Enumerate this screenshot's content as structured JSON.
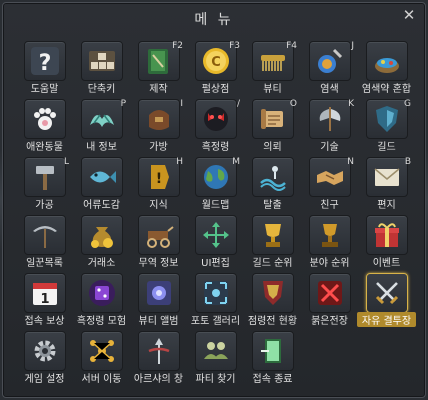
{
  "window": {
    "title": "메 뉴",
    "close_label": "✕"
  },
  "items": [
    {
      "label": "도움말",
      "hotkey": "",
      "icon": "question-icon"
    },
    {
      "label": "단축키",
      "hotkey": "",
      "icon": "keyboard-icon"
    },
    {
      "label": "제작",
      "hotkey": "F2",
      "icon": "crafting-book-icon"
    },
    {
      "label": "펄상점",
      "hotkey": "F3",
      "icon": "pearl-coin-icon"
    },
    {
      "label": "뷰티",
      "hotkey": "F4",
      "icon": "comb-icon"
    },
    {
      "label": "염색",
      "hotkey": "J",
      "icon": "dye-brush-icon"
    },
    {
      "label": "염색약 혼합",
      "hotkey": "",
      "icon": "dye-mix-icon"
    },
    {
      "label": "애완동물",
      "hotkey": "",
      "icon": "paw-icon"
    },
    {
      "label": "내 정보",
      "hotkey": "P",
      "icon": "character-wings-icon"
    },
    {
      "label": "가방",
      "hotkey": "I",
      "icon": "bag-icon"
    },
    {
      "label": "흑정령",
      "hotkey": "/",
      "icon": "black-spirit-icon"
    },
    {
      "label": "의뢰",
      "hotkey": "O",
      "icon": "scroll-icon"
    },
    {
      "label": "기술",
      "hotkey": "K",
      "icon": "axe-icon"
    },
    {
      "label": "길드",
      "hotkey": "G",
      "icon": "guild-shield-icon"
    },
    {
      "label": "가공",
      "hotkey": "L",
      "icon": "hammer-icon"
    },
    {
      "label": "어류도감",
      "hotkey": "",
      "icon": "fish-icon"
    },
    {
      "label": "지식",
      "hotkey": "H",
      "icon": "knowledge-icon"
    },
    {
      "label": "월드맵",
      "hotkey": "M",
      "icon": "globe-icon"
    },
    {
      "label": "탈출",
      "hotkey": "",
      "icon": "escape-icon"
    },
    {
      "label": "친구",
      "hotkey": "N",
      "icon": "handshake-icon"
    },
    {
      "label": "편지",
      "hotkey": "B",
      "icon": "envelope-icon"
    },
    {
      "label": "일꾼목록",
      "hotkey": "",
      "icon": "pickaxe-icon"
    },
    {
      "label": "거래소",
      "hotkey": "",
      "icon": "money-bag-icon"
    },
    {
      "label": "무역 정보",
      "hotkey": "",
      "icon": "cart-icon"
    },
    {
      "label": "UI편집",
      "hotkey": "",
      "icon": "move-arrows-icon"
    },
    {
      "label": "길드 순위",
      "hotkey": "",
      "icon": "trophy-icon"
    },
    {
      "label": "분야 순위",
      "hotkey": "",
      "icon": "ranking-cup-icon"
    },
    {
      "label": "이벤트",
      "hotkey": "",
      "icon": "gift-box-icon"
    },
    {
      "label": "접속 보상",
      "hotkey": "",
      "icon": "calendar-icon"
    },
    {
      "label": "흑정령 모험",
      "hotkey": "",
      "icon": "dice-icon"
    },
    {
      "label": "뷰티 앨범",
      "hotkey": "",
      "icon": "album-icon"
    },
    {
      "label": "포토 갤러리",
      "hotkey": "",
      "icon": "photo-gallery-icon"
    },
    {
      "label": "점령전 현황",
      "hotkey": "",
      "icon": "siege-shield-icon"
    },
    {
      "label": "붉은전장",
      "hotkey": "",
      "icon": "red-battlefield-icon"
    },
    {
      "label": "자유 결투장",
      "hotkey": "",
      "icon": "crossed-swords-icon"
    },
    {
      "label": "게임 설정",
      "hotkey": "",
      "icon": "gear-icon"
    },
    {
      "label": "서버 이동",
      "hotkey": "",
      "icon": "server-move-icon"
    },
    {
      "label": "아르샤의 창",
      "hotkey": "",
      "icon": "arsha-spear-icon"
    },
    {
      "label": "파티 찾기",
      "hotkey": "",
      "icon": "party-find-icon"
    },
    {
      "label": "접속 종료",
      "hotkey": "",
      "icon": "logout-door-icon"
    }
  ],
  "active_item": "자유 결투장"
}
